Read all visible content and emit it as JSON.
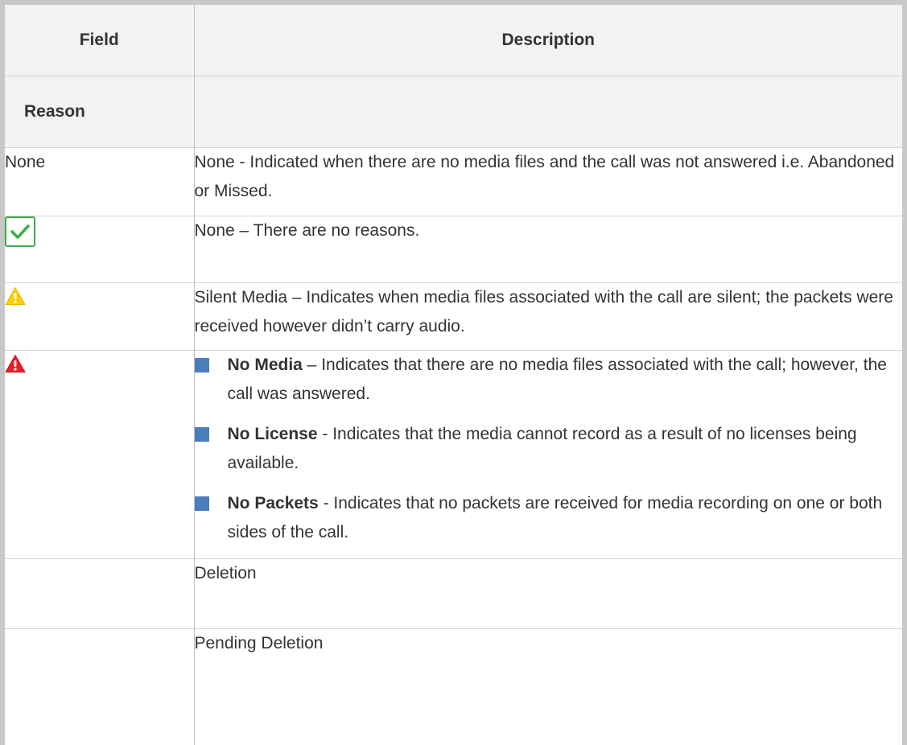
{
  "table": {
    "headers": {
      "field": "Field",
      "description": "Description"
    },
    "section": {
      "label": "Reason"
    },
    "rows": {
      "none": {
        "field": "None",
        "description": "None - Indicated when there are no media files and the call was not answered i.e. Abandoned or Missed."
      },
      "ok": {
        "icon": "green-check-icon",
        "description": "None – There are no reasons."
      },
      "silent": {
        "icon": "yellow-warning-icon",
        "description": "Silent Media – Indicates when media files associated with the call are silent; the packets were received however didn’t carry audio."
      },
      "error": {
        "icon": "red-warning-icon",
        "items": [
          {
            "term": "No Media",
            "text": " – Indicates that there are no media files associated with the call; however, the call was answered."
          },
          {
            "term": "No License",
            "text": " - Indicates that the media cannot record as a result of no licenses being available."
          },
          {
            "term": "No Packets",
            "text": " - Indicates that no packets are received for media recording on one or both sides of the call."
          }
        ]
      },
      "deletion": {
        "description": "Deletion"
      },
      "pending": {
        "description": "Pending Deletion"
      }
    }
  },
  "colors": {
    "header_bg": "#f2f2f2",
    "border": "#c8c8c8",
    "check_green": "#3dae48",
    "warning_yellow": "#f7d200",
    "warning_red": "#e8202a",
    "bullet_blue": "#4a7ebb"
  }
}
